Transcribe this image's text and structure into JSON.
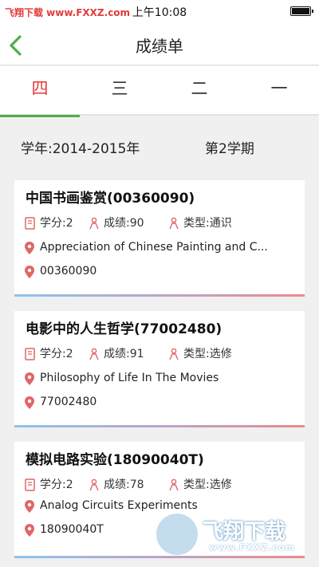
{
  "status_bar": {
    "watermark": "飞翔下载 www.FXXZ.com",
    "time": "上午10:08"
  },
  "nav": {
    "title": "成绩单"
  },
  "tabs": [
    {
      "label": "四",
      "active": true
    },
    {
      "label": "三",
      "active": false
    },
    {
      "label": "二",
      "active": false
    },
    {
      "label": "一",
      "active": false
    }
  ],
  "term_info": {
    "year": "学年:2014-2015年",
    "term": "第2学期"
  },
  "courses": [
    {
      "title": "中国书画鉴赏(00360090)",
      "credit": "学分:2",
      "score": "成绩:90",
      "type": "类型:通识",
      "english_name": "Appreciation of Chinese Painting and C...",
      "code": "00360090"
    },
    {
      "title": "电影中的人生哲学(77002480)",
      "credit": "学分:2",
      "score": "成绩:91",
      "type": "类型:选修",
      "english_name": "Philosophy of Life In The Movies",
      "code": "77002480"
    },
    {
      "title": "模拟电路实验(18090040T)",
      "credit": "学分:2",
      "score": "成绩:78",
      "type": "类型:选修",
      "english_name": "Analog Circuits Experiments",
      "code": "18090040T"
    }
  ],
  "watermark": {
    "text": "飞翔下载",
    "url": "www.FXXZ.com"
  },
  "colors": {
    "accent_green": "#4cae4c",
    "active_tab_red": "#e23a3a",
    "icon_red": "#e06666"
  }
}
